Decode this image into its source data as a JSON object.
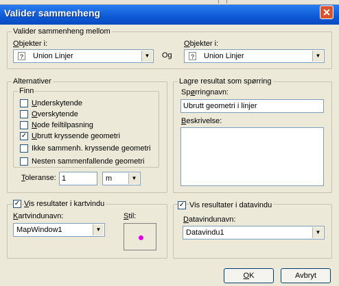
{
  "window": {
    "title": "Valider sammenheng",
    "close_label": "✕"
  },
  "source_group": {
    "label": "Valider sammenheng mellom",
    "left": {
      "label_prefix": "O",
      "label_rest": "bjekter i:",
      "value": "Union Linjer"
    },
    "og": "Og",
    "right": {
      "label_prefix": "O",
      "label_rest": "bjekter i:",
      "value": "Union Linjer"
    }
  },
  "alternatives": {
    "label": "Alternativer",
    "finn_label": "Finn",
    "options": [
      {
        "prefix": "U",
        "rest": "nderskytende",
        "checked": false
      },
      {
        "prefix": "O",
        "rest": "verskytende",
        "checked": false
      },
      {
        "prefix": "N",
        "rest": "ode feiltilpasning",
        "checked": false
      },
      {
        "prefix": "U",
        "rest": "brutt kryssende geometri",
        "checked": true
      },
      {
        "prefix": "",
        "rest": "Ikke sammenh. kryssende geometri",
        "checked": false
      },
      {
        "prefix": "",
        "rest": "Nesten sammenfallende geometri",
        "checked": false
      }
    ],
    "tolerance_prefix": "T",
    "tolerance_rest": "oleranse:",
    "tolerance_value": "1",
    "unit_value": "m"
  },
  "save_group": {
    "label": "Lagre resultat som spørring",
    "query_label_prefix": "Sp",
    "query_label_u": "ø",
    "query_label_rest": "rringnavn:",
    "query_value": "Ubrutt geometri i linjer",
    "desc_label_prefix": "B",
    "desc_label_rest": "eskrivelse:",
    "desc_value": ""
  },
  "map_group": {
    "checkbox_label_prefix": "V",
    "checkbox_label_rest": "is resultater i kartvindu",
    "checked": true,
    "name_label_prefix": "K",
    "name_label_rest": "artvindunavn:",
    "name_value": "MapWindow1",
    "style_label_prefix": "S",
    "style_label_rest": "til:",
    "style_color": "#e000e0"
  },
  "data_group": {
    "checkbox_label": "Vis resultater i datavindu",
    "checked": true,
    "name_label_prefix": "D",
    "name_label_rest": "atavindunavn:",
    "name_value": "Datavindu1"
  },
  "buttons": {
    "ok_prefix": "O",
    "ok_rest": "K",
    "cancel": "Avbryt"
  }
}
